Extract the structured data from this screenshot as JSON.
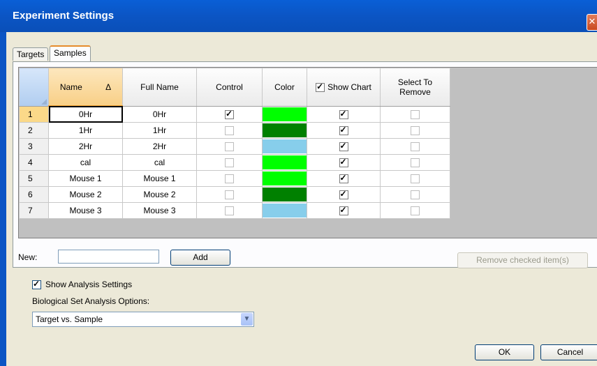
{
  "window": {
    "title": "Experiment Settings",
    "close_glyph": "✕"
  },
  "tabs": [
    {
      "label": "Targets",
      "active": false
    },
    {
      "label": "Samples",
      "active": true
    }
  ],
  "grid": {
    "columns": {
      "name": "Name",
      "full_name": "Full Name",
      "control": "Control",
      "color": "Color",
      "show_chart": "Show Chart",
      "select_to_remove": "Select To Remove"
    },
    "sort_indicator": "Δ",
    "rows": [
      {
        "num": "1",
        "name": "0Hr",
        "full_name": "0Hr",
        "control": true,
        "color": "#00ff00",
        "show_chart": true,
        "remove": false
      },
      {
        "num": "2",
        "name": "1Hr",
        "full_name": "1Hr",
        "control": false,
        "color": "#008000",
        "show_chart": true,
        "remove": false
      },
      {
        "num": "3",
        "name": "2Hr",
        "full_name": "2Hr",
        "control": false,
        "color": "#87ceeb",
        "show_chart": true,
        "remove": false
      },
      {
        "num": "4",
        "name": "cal",
        "full_name": "cal",
        "control": false,
        "color": "#00ff00",
        "show_chart": true,
        "remove": false
      },
      {
        "num": "5",
        "name": "Mouse 1",
        "full_name": "Mouse 1",
        "control": false,
        "color": "#00ff00",
        "show_chart": true,
        "remove": false
      },
      {
        "num": "6",
        "name": "Mouse 2",
        "full_name": "Mouse 2",
        "control": false,
        "color": "#008000",
        "show_chart": true,
        "remove": false
      },
      {
        "num": "7",
        "name": "Mouse 3",
        "full_name": "Mouse 3",
        "control": false,
        "color": "#87ceeb",
        "show_chart": true,
        "remove": false
      }
    ]
  },
  "new_item": {
    "label": "New:",
    "value": "",
    "add_label": "Add"
  },
  "remove_label": "Remove checked item(s)",
  "analysis": {
    "show_label": "Show Analysis Settings",
    "show_checked": true,
    "options_label": "Biological Set Analysis Options:",
    "selected_option": "Target vs. Sample"
  },
  "footer": {
    "ok_label": "OK",
    "cancel_label": "Cancel"
  }
}
